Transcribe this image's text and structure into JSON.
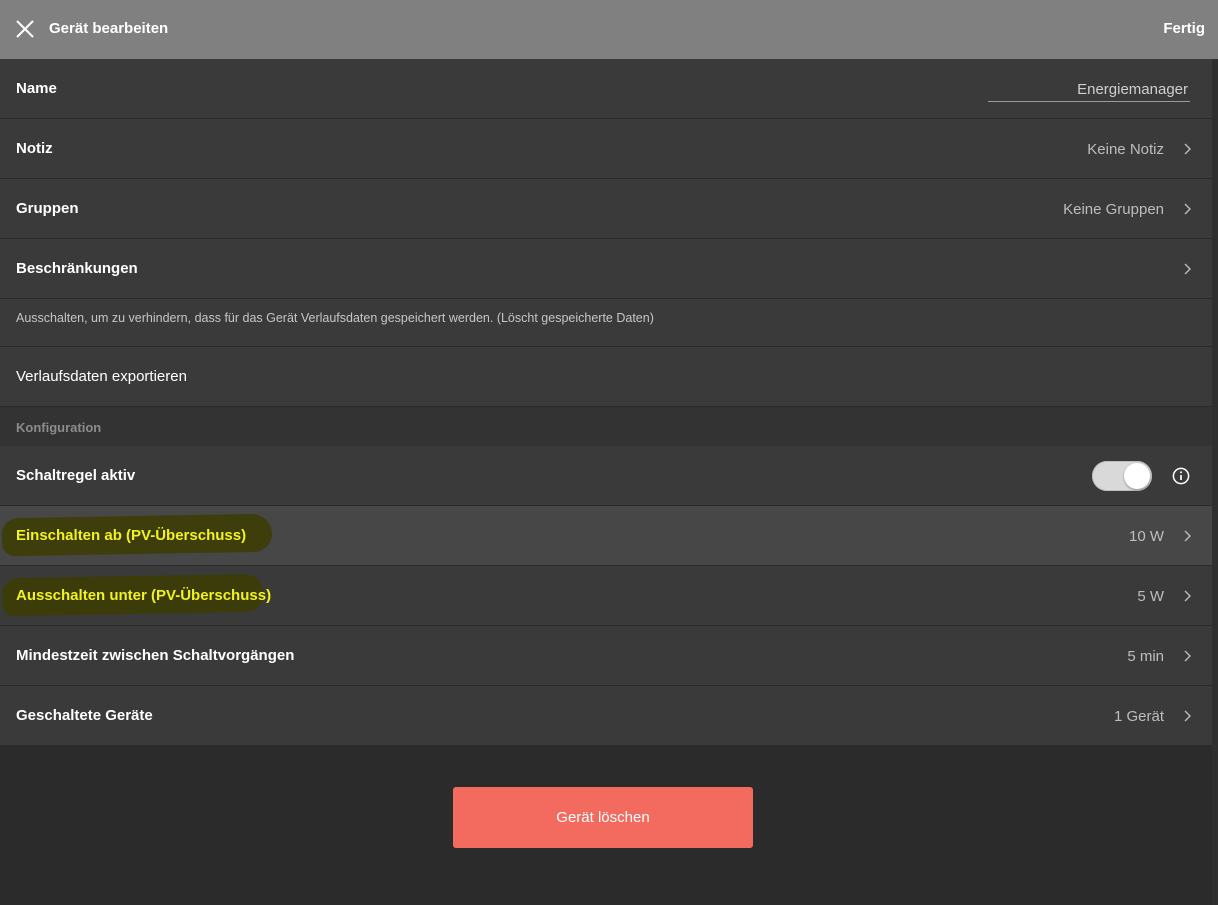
{
  "header": {
    "title": "Gerät bearbeiten",
    "done_label": "Fertig",
    "close_icon": "close-icon"
  },
  "rows": {
    "name": {
      "label": "Name",
      "value": "Energiemanager"
    },
    "note": {
      "label": "Notiz",
      "value": "Keine Notiz"
    },
    "groups": {
      "label": "Gruppen",
      "value": "Keine Gruppen"
    },
    "restrictions": {
      "label": "Beschränkungen"
    },
    "history_hint": "Ausschalten, um zu verhindern, dass für das Gerät Verlaufsdaten gespeichert werden. (Löscht gespeicherte Daten)",
    "export": {
      "label": "Verlaufsdaten exportieren"
    }
  },
  "config": {
    "section_title": "Konfiguration",
    "rule_active": {
      "label": "Schaltregel aktiv",
      "enabled": true
    },
    "switch_on": {
      "label": "Einschalten ab (PV-Überschuss)",
      "value": "10 W"
    },
    "switch_off": {
      "label": "Ausschalten unter (PV-Überschuss)",
      "value": "5 W"
    },
    "min_time": {
      "label": "Mindestzeit zwischen Schaltvorgängen",
      "value": "5 min"
    },
    "switched_devices": {
      "label": "Geschaltete Geräte",
      "value": "1 Gerät"
    }
  },
  "delete_label": "Gerät löschen",
  "colors": {
    "header_bg": "#808080",
    "row_bg": "#3a3a3a",
    "highlight_text": "#f2f21e",
    "delete_bg": "#f36b5e"
  }
}
